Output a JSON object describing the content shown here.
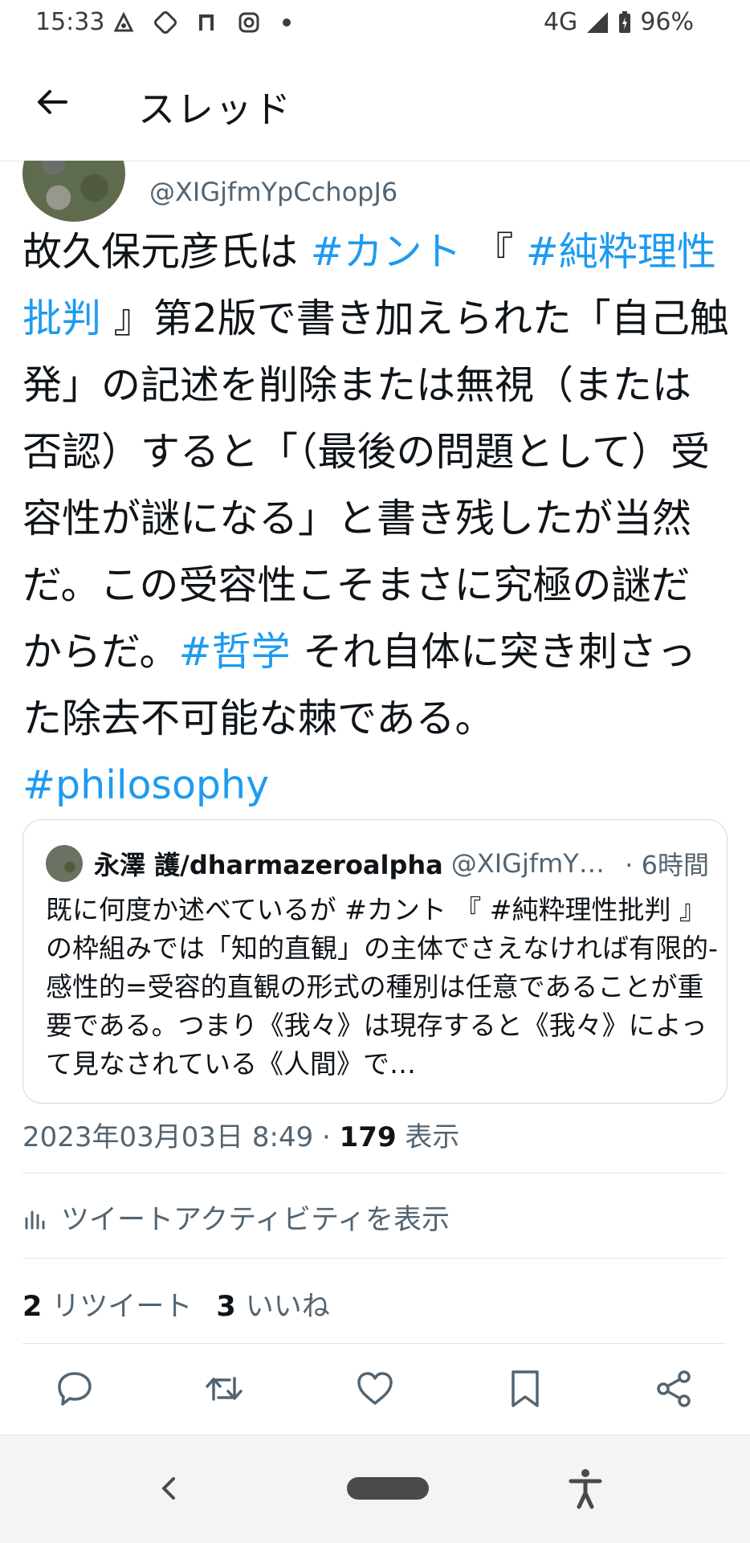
{
  "status_bar": {
    "time": "15:33",
    "network": "4G",
    "battery": "96%"
  },
  "header": {
    "title": "スレッド"
  },
  "author": {
    "handle": "@XIGjfmYpCchopJ6"
  },
  "tweet": {
    "segments": [
      {
        "t": "故久保元彦氏は ",
        "tag": false
      },
      {
        "t": "#カント",
        "tag": true
      },
      {
        "t": " 『 ",
        "tag": false
      },
      {
        "t": "#純粋理性批判",
        "tag": true
      },
      {
        "t": " 』第2版で書き加えられた「自己触発」の記述を削除または無視（または否認）すると「（最後の問題として）受容性が謎になる」と書き残したが当然だ。この受容性こそまさに究極の謎だからだ。",
        "tag": false
      },
      {
        "t": "#哲学",
        "tag": true
      },
      {
        "t": " それ自体に突き刺さった除去不可能な棘である。",
        "tag": false
      },
      {
        "t": "#philosophy",
        "tag": true
      }
    ]
  },
  "quote": {
    "name": "永澤 護/dharmazeroalpha",
    "handle": "@XIGjfmYp...",
    "time": "· 6時間",
    "text": "既に何度か述べているが #カント 『 #純粋理性批判 』の枠組みでは「知的直観」の主体でさえなければ有限的-感性的=受容的直観の形式の種別は任意であることが重要である。つまり《我々》は現存すると《我々》によって見なされている《人間》で…"
  },
  "meta": {
    "datetime": "2023年03月03日 8:49 · ",
    "views_count": "179",
    "views_label": " 表示"
  },
  "activity": {
    "label": "ツイートアクティビティを表示"
  },
  "stats": {
    "retweets_count": "2",
    "retweets_label": "リツイート",
    "likes_count": "3",
    "likes_label": "いいね"
  },
  "colors": {
    "hashtag": "#1d9bf0",
    "text": "#0f1419",
    "secondary": "#536471"
  }
}
